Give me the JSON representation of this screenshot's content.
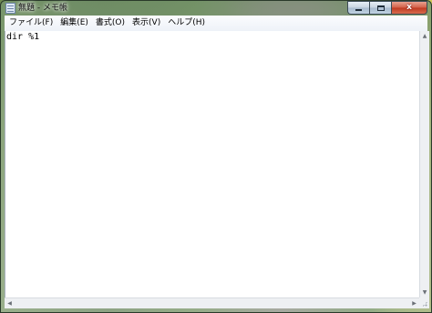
{
  "window": {
    "title": "無題 - メモ帳",
    "caption": {
      "minimize_label": "",
      "maximize_label": "",
      "close_label": "x"
    }
  },
  "menubar": {
    "items": [
      {
        "label": "ファイル(F)"
      },
      {
        "label": "編集(E)"
      },
      {
        "label": "書式(O)"
      },
      {
        "label": "表示(V)"
      },
      {
        "label": "ヘルプ(H)"
      }
    ]
  },
  "editor": {
    "content": "dir %1"
  },
  "icons": {
    "app": "notepad-icon",
    "scroll_up": "chevron-up-icon",
    "scroll_down": "chevron-down-icon",
    "scroll_left": "chevron-left-icon",
    "scroll_right": "chevron-right-icon",
    "grip": "size-grip-icon"
  },
  "colors": {
    "close_button": "#c8452b",
    "menubar_bg": "#f4f7fb",
    "editor_bg": "#ffffff"
  }
}
